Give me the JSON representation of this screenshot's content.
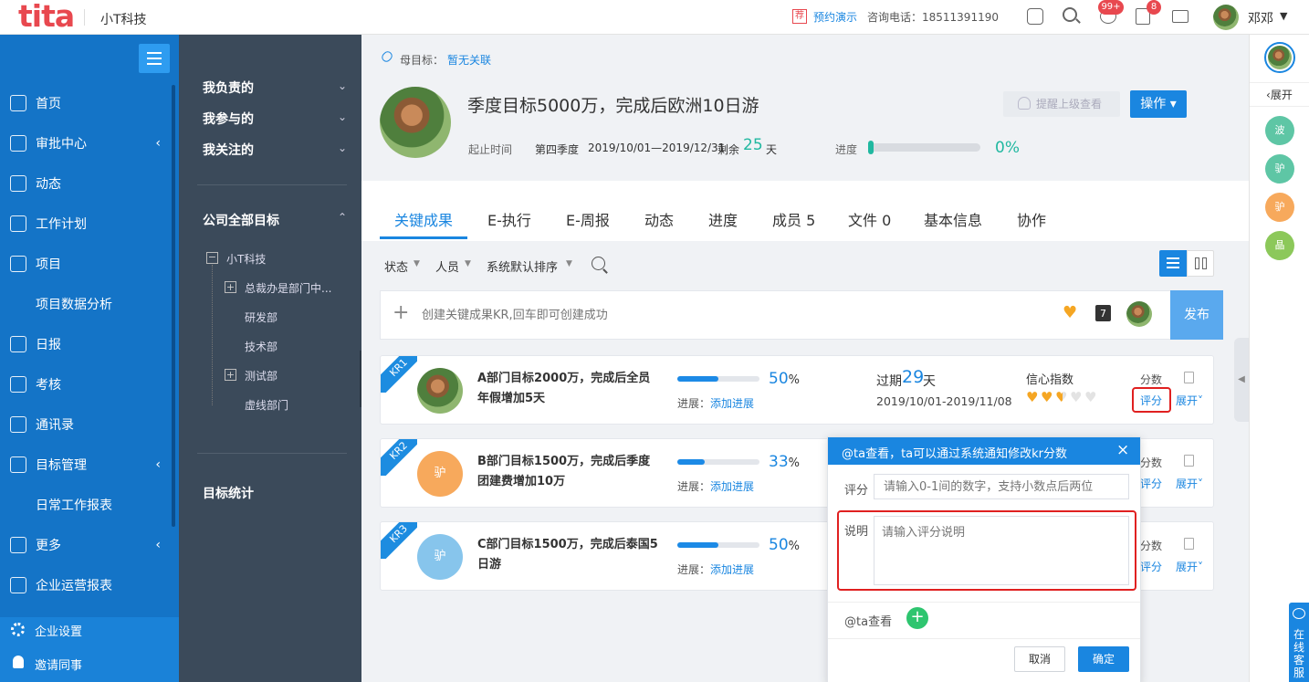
{
  "topbar": {
    "logo": "tita",
    "company": "小T科技",
    "recommend_badge": "荐",
    "demo_link": "预约演示",
    "phone_label": "咨询电话：18511391190",
    "badge_messages": "99+",
    "badge_tasks": "8",
    "user_name": "邓邓"
  },
  "leftnav": {
    "items": [
      {
        "label": "首页",
        "icon": "home-icon"
      },
      {
        "label": "审批中心",
        "icon": "approval-icon",
        "chevron": "‹"
      },
      {
        "label": "动态",
        "icon": "feed-icon"
      },
      {
        "label": "工作计划",
        "icon": "list-icon"
      },
      {
        "label": "项目",
        "icon": "project-icon"
      },
      {
        "label": "项目数据分析",
        "icon": ""
      },
      {
        "label": "日报",
        "icon": "daily-icon"
      },
      {
        "label": "考核",
        "icon": "assess-icon"
      },
      {
        "label": "通讯录",
        "icon": "contacts-icon"
      },
      {
        "label": "目标管理",
        "icon": "target-icon",
        "chevron": "‹"
      },
      {
        "label": "日常工作报表",
        "icon": ""
      },
      {
        "label": "更多",
        "icon": "more-icon",
        "chevron": "‹"
      },
      {
        "label": "企业运营报表",
        "icon": "report-icon"
      }
    ],
    "settings": "企业设置",
    "invite": "邀请同事"
  },
  "secondnav": {
    "mine": "我负责的",
    "joined": "我参与的",
    "followed": "我关注的",
    "all_goals": "公司全部目标",
    "tree": [
      "小T科技",
      "总裁办是部门中...",
      "研发部",
      "技术部",
      "测试部",
      "虚线部门"
    ],
    "stats": "目标统计"
  },
  "goal": {
    "parent_label": "母目标：",
    "parent_value": "暂无关联",
    "title": "季度目标5000万，完成后欧洲10日游",
    "time_label": "起止时间",
    "quarter": "第四季度",
    "range": "2019/10/01—2019/12/31",
    "remain_prefix": "剩余",
    "remain_days": "25",
    "remain_suffix": "天",
    "progress_label": "进度",
    "progress_pct": "0%",
    "progress_value": 0,
    "remind_button": "提醒上级查看",
    "action_button": "操作 ▾"
  },
  "tabs": [
    "关键成果",
    "E-执行",
    "E-周报",
    "动态",
    "进度",
    "成员 5",
    "文件 0",
    "基本信息",
    "协作"
  ],
  "filters": {
    "status": "状态",
    "person": "人员",
    "sort": "系统默认排序"
  },
  "create": {
    "placeholder": "创建关键成果KR,回车即可创建成功",
    "calendar_day": "7",
    "publish": "发布"
  },
  "krs": [
    {
      "tag": "KR1",
      "title": "A部门目标2000万，完成后全员年假增加5天",
      "progress": 50,
      "pct_num": "50",
      "pct_sign": "%",
      "progress_label": "进展：",
      "progress_link": "添加进展",
      "avatar_text": "",
      "avatar_color": "#c98a5a"
    },
    {
      "tag": "KR2",
      "title": "B部门目标1500万，完成后季度团建费增加10万",
      "progress": 33,
      "pct_num": "33",
      "pct_sign": "%",
      "progress_label": "进展：",
      "progress_link": "添加进展",
      "avatar_text": "驴",
      "avatar_color": "#f7a95c"
    },
    {
      "tag": "KR3",
      "title": "C部门目标1500万，完成后泰国5日游",
      "progress": 50,
      "pct_num": "50",
      "pct_sign": "%",
      "progress_label": "进展：",
      "progress_link": "添加进展",
      "avatar_text": "驴",
      "avatar_color": "#87c5ec"
    }
  ],
  "kr1_extra": {
    "overdue_prefix": "过期",
    "overdue_days": "29",
    "overdue_suffix": "天",
    "date_range": "2019/10/01-2019/11/08",
    "confidence_label": "信心指数",
    "confidence": 2.5,
    "confidence_max": 5
  },
  "kr_actions": {
    "score_label": "分数",
    "rate_link": "评分",
    "expand_link": "展开"
  },
  "popup": {
    "title": "@ta查看，ta可以通过系统通知修改kr分数",
    "close": "×",
    "score_label": "评分",
    "score_placeholder": "请输入0-1间的数字，支持小数点后两位",
    "note_label": "说明",
    "note_placeholder": "请输入评分说明",
    "mention_label": "@ta查看",
    "cancel": "取消",
    "confirm": "确定"
  },
  "rightbar": {
    "expand": "展开",
    "members": [
      {
        "text": "波",
        "color": "#5ec6a5"
      },
      {
        "text": "驴",
        "color": "#5ec6a5"
      },
      {
        "text": "驴",
        "color": "#f7a95c"
      },
      {
        "text": "晶",
        "color": "#8cc85a"
      }
    ],
    "online_service": "在线客服"
  },
  "colors": {
    "brand_blue": "#1474c7",
    "accent_blue": "#1a86e0",
    "green_days": "#20b8a0",
    "logo_red": "#e8484f",
    "highlight_red": "#e02020",
    "heart_orange": "#f5a623"
  }
}
